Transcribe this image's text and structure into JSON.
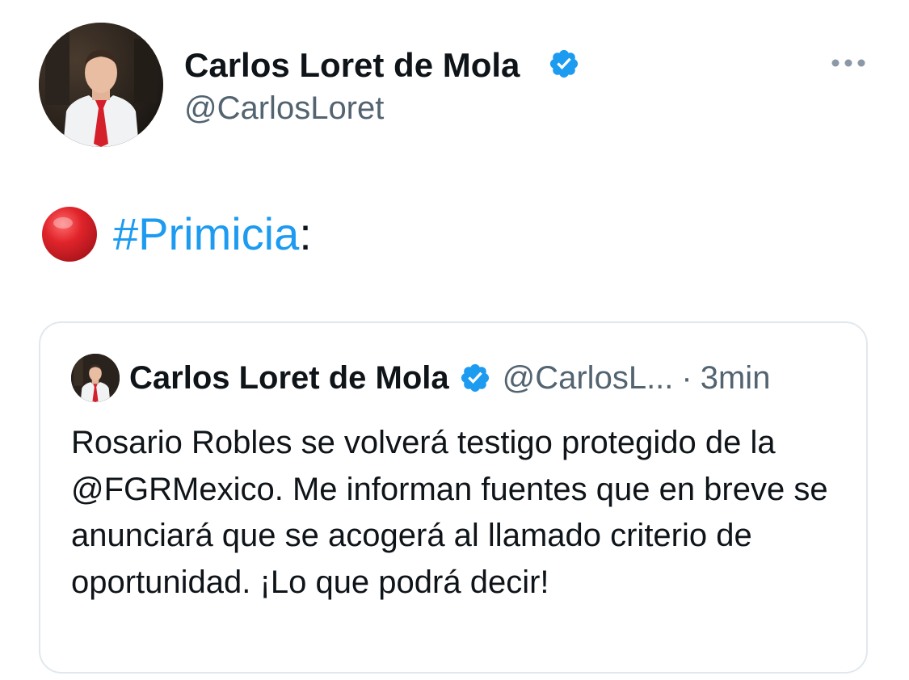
{
  "tweet": {
    "author_name": "Carlos Loret de Mola",
    "handle": "@CarlosLoret",
    "text": {
      "hashtag": "#Primicia",
      "suffix": ":"
    }
  },
  "quoted_tweet": {
    "author_name": "Carlos Loret de Mola",
    "handle": "@CarlosL...",
    "separator": "·",
    "time": "3min",
    "text_before": "Rosario Robles se volverá testigo protegido de la ",
    "mention": "@FGRMexico",
    "text_after": ". Me informan fuentes que en breve se anunciará que se acogerá al llamado criterio de oportunidad. ¡Lo que podrá decir!"
  },
  "icons": {
    "verified": "verified-badge-icon",
    "more": "more-options-icon",
    "emoji": "red-circle-icon"
  },
  "colors": {
    "link": "#1d9bf0",
    "secondary_text": "#536471",
    "primary_text": "#0f1419",
    "border": "#e1e8ed",
    "emoji_red": "#dd2e44"
  }
}
